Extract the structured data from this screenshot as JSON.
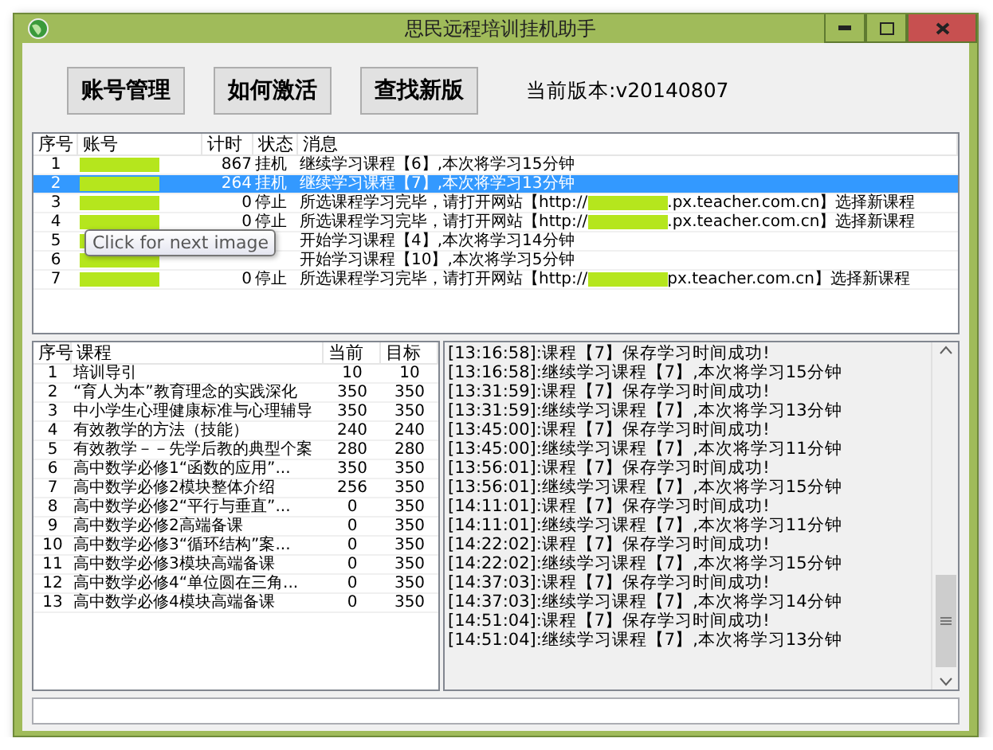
{
  "window": {
    "title": "思民远程培训挂机助手"
  },
  "toolbar": {
    "buttons": [
      "账号管理",
      "如何激活",
      "查找新版"
    ],
    "version": "当前版本:v20140807"
  },
  "accounts": {
    "columns": [
      "序号",
      "账号",
      "计时",
      "状态",
      "消息"
    ],
    "rows": [
      {
        "index": "1",
        "account_redacted": true,
        "timer": "867",
        "status": "挂机",
        "message_parts": [
          "继续学习课程【6】,本次将学习15分钟"
        ],
        "selected": false
      },
      {
        "index": "2",
        "account_redacted": true,
        "timer": "264",
        "status": "挂机",
        "message_parts": [
          "继续学习课程【7】,本次将学习13分钟"
        ],
        "selected": true
      },
      {
        "index": "3",
        "account_redacted": true,
        "timer": "0",
        "status": "停止",
        "message_parts": [
          "所选课程学习完毕，请打开网站【http://",
          ".px.teacher.com.cn】选择新课程"
        ],
        "selected": false
      },
      {
        "index": "4",
        "account_redacted": true,
        "timer": "0",
        "status": "停止",
        "message_parts": [
          "所选课程学习完毕，请打开网站【http://",
          ".px.teacher.com.cn】选择新课程"
        ],
        "selected": false
      },
      {
        "index": "5",
        "account_redacted": true,
        "message_parts": [
          "开始学习课程【4】,本次将学习14分钟"
        ],
        "selected": false
      },
      {
        "index": "6",
        "account_redacted": true,
        "message_parts": [
          "开始学习课程【10】,本次将学习5分钟"
        ],
        "selected": false
      },
      {
        "index": "7",
        "account_redacted": true,
        "timer": "0",
        "status": "停止",
        "message_parts": [
          "所选课程学习完毕，请打开网站【http://",
          "px.teacher.com.cn】选择新课程"
        ],
        "selected": false
      }
    ]
  },
  "tooltip": "Click for next image",
  "courses": {
    "columns": [
      "序号",
      "课程",
      "当前",
      "目标"
    ],
    "rows": [
      [
        "1",
        "培训导引",
        "10",
        "10"
      ],
      [
        "2",
        "“育人为本”教育理念的实践深化",
        "350",
        "350"
      ],
      [
        "3",
        "中小学生心理健康标准与心理辅导",
        "350",
        "350"
      ],
      [
        "4",
        "有效教学的方法（技能）",
        "240",
        "240"
      ],
      [
        "5",
        "有效教学－－先学后教的典型个案",
        "280",
        "280"
      ],
      [
        "6",
        "高中数学必修1“函数的应用”...",
        "350",
        "350"
      ],
      [
        "7",
        "高中数学必修2模块整体介绍",
        "256",
        "350"
      ],
      [
        "8",
        "高中数学必修2“平行与垂直”...",
        "0",
        "350"
      ],
      [
        "9",
        "高中数学必修2高端备课",
        "0",
        "350"
      ],
      [
        "10",
        "高中数学必修3“循环结构”案...",
        "0",
        "350"
      ],
      [
        "11",
        "高中数学必修3模块高端备课",
        "0",
        "350"
      ],
      [
        "12",
        "高中数学必修4“单位圆在三角...",
        "0",
        "350"
      ],
      [
        "13",
        "高中数学必修4模块高端备课",
        "0",
        "350"
      ]
    ]
  },
  "log": [
    "[13:16:58]:课程【7】保存学习时间成功!",
    "[13:16:58]:继续学习课程【7】,本次将学习15分钟",
    "[13:31:59]:课程【7】保存学习时间成功!",
    "[13:31:59]:继续学习课程【7】,本次将学习13分钟",
    "[13:45:00]:课程【7】保存学习时间成功!",
    "[13:45:00]:继续学习课程【7】,本次将学习11分钟",
    "[13:56:01]:课程【7】保存学习时间成功!",
    "[13:56:01]:继续学习课程【7】,本次将学习15分钟",
    "[14:11:01]:课程【7】保存学习时间成功!",
    "[14:11:01]:继续学习课程【7】,本次将学习11分钟",
    "[14:22:02]:课程【7】保存学习时间成功!",
    "[14:22:02]:继续学习课程【7】,本次将学习15分钟",
    "[14:37:03]:课程【7】保存学习时间成功!",
    "[14:37:03]:继续学习课程【7】,本次将学习14分钟",
    "[14:51:04]:课程【7】保存学习时间成功!",
    "[14:51:04]:继续学习课程【7】,本次将学习13分钟"
  ]
}
